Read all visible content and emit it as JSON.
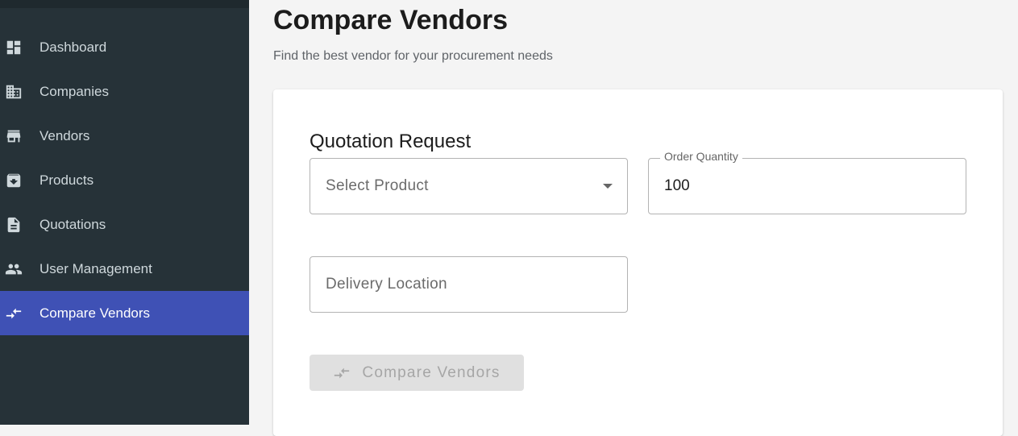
{
  "sidebar": {
    "items": [
      {
        "label": "Dashboard",
        "icon": "dashboard-icon",
        "active": false
      },
      {
        "label": "Companies",
        "icon": "business-icon",
        "active": false
      },
      {
        "label": "Vendors",
        "icon": "store-icon",
        "active": false
      },
      {
        "label": "Products",
        "icon": "archive-icon",
        "active": false
      },
      {
        "label": "Quotations",
        "icon": "document-icon",
        "active": false
      },
      {
        "label": "User Management",
        "icon": "people-icon",
        "active": false
      },
      {
        "label": "Compare Vendors",
        "icon": "compare-arrows-icon",
        "active": true
      }
    ]
  },
  "page": {
    "title": "Compare Vendors",
    "subtitle": "Find the best vendor for your procurement needs"
  },
  "form": {
    "section_title": "Quotation Request",
    "product_select": {
      "placeholder": "Select Product"
    },
    "order_quantity": {
      "label": "Order Quantity",
      "value": "100"
    },
    "delivery_location": {
      "placeholder": "Delivery Location",
      "value": ""
    },
    "submit": {
      "label": "Compare Vendors",
      "icon": "compare-arrows-icon",
      "disabled": true
    }
  },
  "colors": {
    "sidebar_bg": "#263238",
    "active_item_bg": "#3f51b5",
    "page_bg": "#f4f4f4",
    "disabled_button_bg": "#e0e0e0"
  }
}
